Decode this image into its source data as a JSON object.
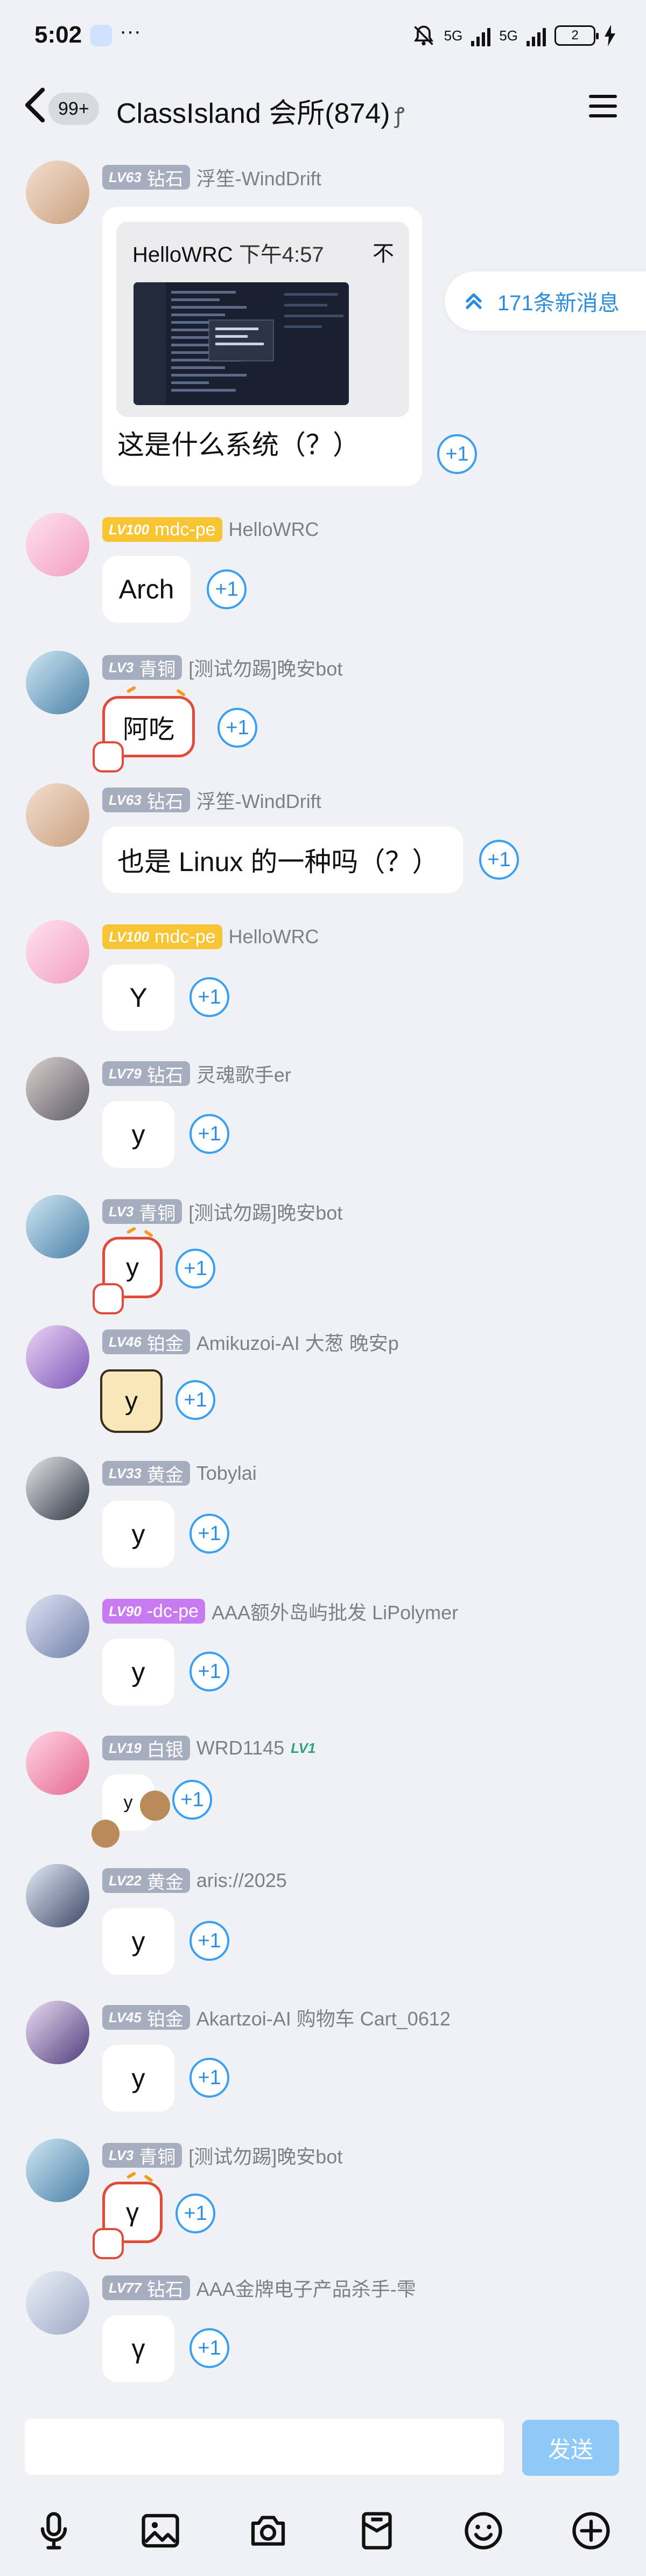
{
  "status": {
    "time": "5:02",
    "dots": "···",
    "net1": "5G",
    "net2": "5G",
    "battery": "2"
  },
  "nav": {
    "unread_badge": "99+",
    "title": "ClassIsland 会所(874)",
    "title_suffix": "ꝭ"
  },
  "new_messages": {
    "label": "171条新消息"
  },
  "reply_preview": {
    "name": "HelloWRC",
    "time": "下午4:57",
    "extra": "不"
  },
  "plus_label": "+1",
  "messages": [
    {
      "level": "LV63",
      "rank": "钻石",
      "nick": "浮笙-WindDrift",
      "text": "这是什么系统（？）"
    },
    {
      "level": "LV100",
      "rank": "mdc-pe",
      "nick": "HelloWRC",
      "text": "Arch"
    },
    {
      "level": "LV3",
      "rank": "青铜",
      "nick": "[测试勿踢]晚安bot",
      "text": "阿吃"
    },
    {
      "level": "LV63",
      "rank": "钻石",
      "nick": "浮笙-WindDrift",
      "text": "也是 Linux 的一种吗（？）"
    },
    {
      "level": "LV100",
      "rank": "mdc-pe",
      "nick": "HelloWRC",
      "text": "Y"
    },
    {
      "level": "LV79",
      "rank": "钻石",
      "nick": "灵魂歌手er",
      "text": "y"
    },
    {
      "level": "LV3",
      "rank": "青铜",
      "nick": "[测试勿踢]晚安bot",
      "text": "y"
    },
    {
      "level": "LV46",
      "rank": "铂金",
      "nick": "Amikuzoi-AI 大葱 晚安p",
      "text": "y"
    },
    {
      "level": "LV33",
      "rank": "黄金",
      "nick": "Tobylai",
      "text": "y"
    },
    {
      "level": "LV90",
      "rank": "-dc-pe",
      "nick": "AAA额外岛屿批发 LiPolymer",
      "text": "y"
    },
    {
      "level": "LV19",
      "rank": "白银",
      "nick": "WRD1145",
      "nick_badge": "LV1",
      "text": "y"
    },
    {
      "level": "LV22",
      "rank": "黄金",
      "nick": "aris://2025",
      "text": "y"
    },
    {
      "level": "LV45",
      "rank": "铂金",
      "nick": "Akartzoi-AI 购物车 Cart_0612",
      "text": "y"
    },
    {
      "level": "LV3",
      "rank": "青铜",
      "nick": "[测试勿踢]晚安bot",
      "text": "γ"
    },
    {
      "level": "LV77",
      "rank": "钻石",
      "nick": "AAA金牌电子产品杀手-雫",
      "text": "γ"
    }
  ],
  "composer": {
    "placeholder": "",
    "send_label": "发送"
  },
  "toolbar": [
    "mic-icon",
    "image-icon",
    "camera-icon",
    "red-packet-icon",
    "emoji-icon",
    "plus-icon"
  ],
  "colors": {
    "accent": "#2d8ee6",
    "level_gray": "#a6adbf",
    "level_gold": "#f7c433",
    "level_purple": "#c87af0",
    "send_disabled": "#8fcaf7"
  }
}
